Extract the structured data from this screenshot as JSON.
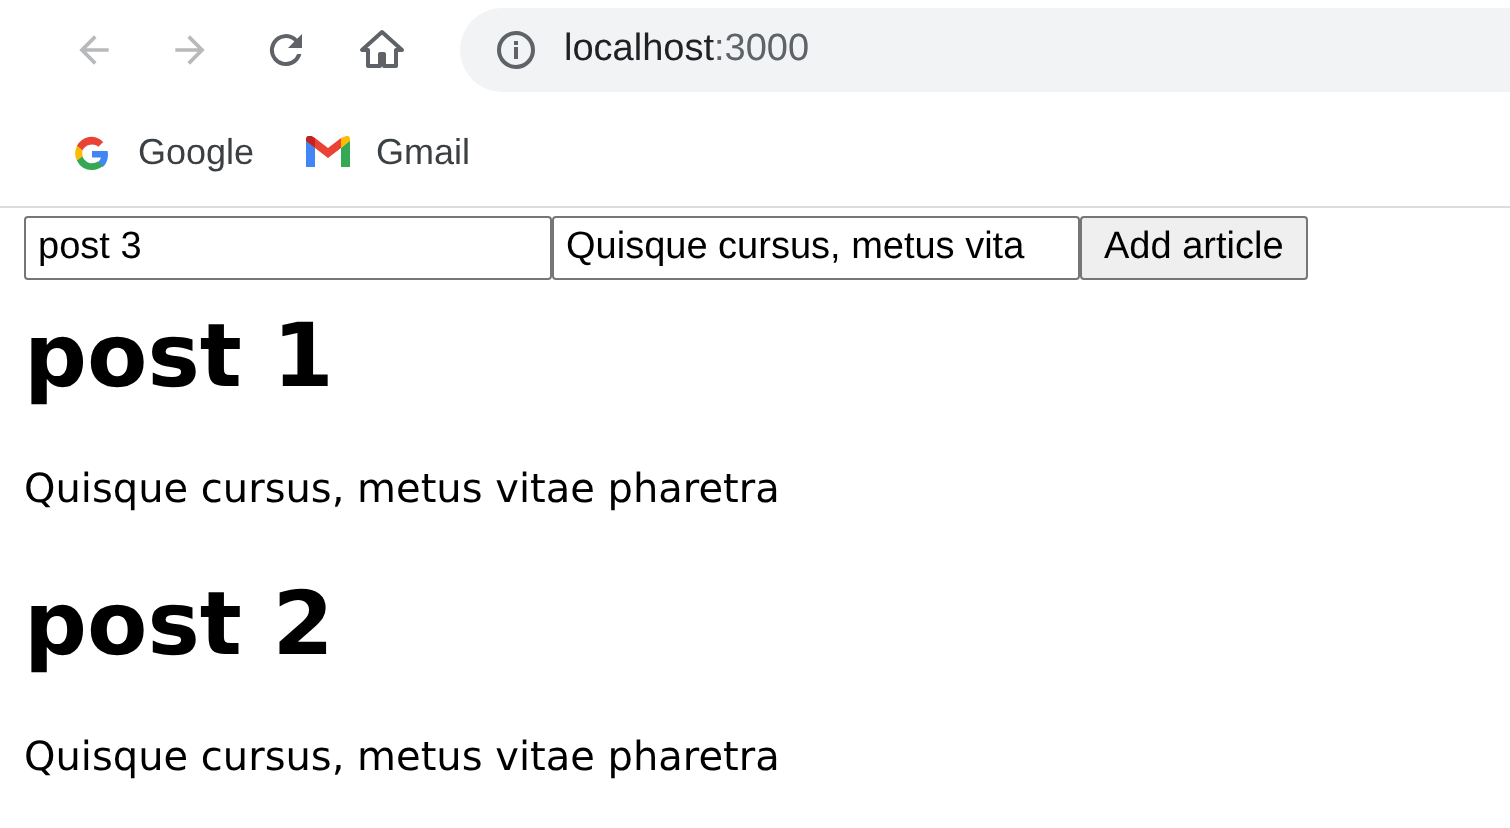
{
  "browser": {
    "url_host": "localhost",
    "url_port": ":3000",
    "bookmarks": [
      {
        "label": "Google",
        "kind": "google"
      },
      {
        "label": "Gmail",
        "kind": "gmail"
      }
    ]
  },
  "form": {
    "title_value": "post 3",
    "body_value": "Quisque cursus, metus vita",
    "button": "Add article"
  },
  "articles": [
    {
      "title": "post 1",
      "body": "Quisque cursus, metus vitae pharetra"
    },
    {
      "title": "post 2",
      "body": "Quisque cursus, metus vitae pharetra"
    }
  ]
}
